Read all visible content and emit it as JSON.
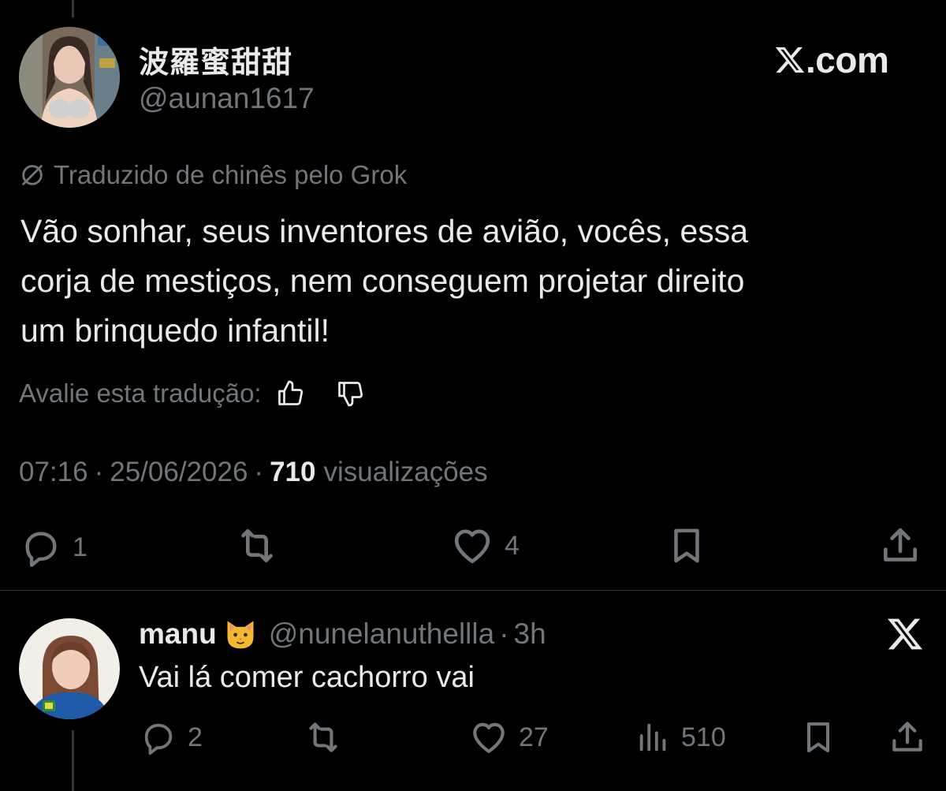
{
  "tweet": {
    "display_name": "波羅蜜甜甜",
    "handle": "@aunan1617",
    "brand": "X.com",
    "translation_notice": "Traduzido de chinês pelo Grok",
    "text": "Vão sonhar, seus inventores de avião, vocês, essa\ncorja de mestiços, nem conseguem projetar direito\num brinquedo infantil!",
    "rate_label": "Avalie esta tradução:",
    "time": "07:16",
    "separator": "·",
    "date": "25/06/2026",
    "views_count": "710",
    "views_label": "visualizações",
    "actions": {
      "reply_count": "1",
      "repost_count": "",
      "like_count": "4"
    },
    "icons": [
      "thread-line",
      "x-logo-icon",
      "translate-icon",
      "thumbs-up-icon",
      "thumbs-down-icon",
      "reply-icon",
      "repost-icon",
      "heart-icon",
      "bookmark-icon",
      "share-icon"
    ]
  },
  "reply": {
    "display_name": "manu",
    "emoji": "cat-face-icon",
    "handle": "@nunelanuthellla",
    "separator": "·",
    "time": "3h",
    "text": "Vai lá comer cachorro vai",
    "actions": {
      "reply_count": "2",
      "like_count": "27",
      "views_count": "510"
    }
  },
  "colors": {
    "background": "#000000",
    "text": "#e7e9ea",
    "muted": "#71767b",
    "divider": "#2f3336"
  }
}
